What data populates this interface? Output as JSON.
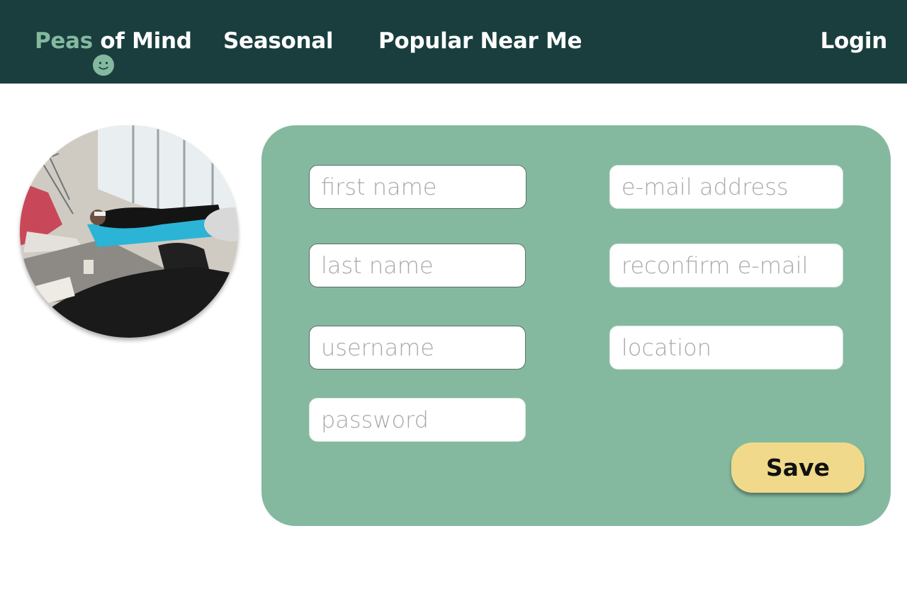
{
  "nav": {
    "logo_part1": "Peas",
    "logo_part2": " of Mind",
    "seasonal": "Seasonal",
    "popular": "Popular Near Me",
    "login": "Login"
  },
  "form": {
    "first_name": {
      "placeholder": "first name",
      "value": ""
    },
    "last_name": {
      "placeholder": "last name",
      "value": ""
    },
    "username": {
      "placeholder": "username",
      "value": ""
    },
    "password": {
      "placeholder": "password",
      "value": ""
    },
    "email": {
      "placeholder": "e-mail address",
      "value": ""
    },
    "reconfirm_email": {
      "placeholder": "reconfirm e-mail",
      "value": ""
    },
    "location": {
      "placeholder": "location",
      "value": ""
    },
    "save_label": "Save"
  },
  "icons": {
    "logo_face": "smiley-face-icon"
  },
  "colors": {
    "navbar_bg": "#1a3e3e",
    "accent_green": "#84b9a0",
    "panel_bg": "#84b9a0",
    "save_bg": "#f0d98a"
  }
}
